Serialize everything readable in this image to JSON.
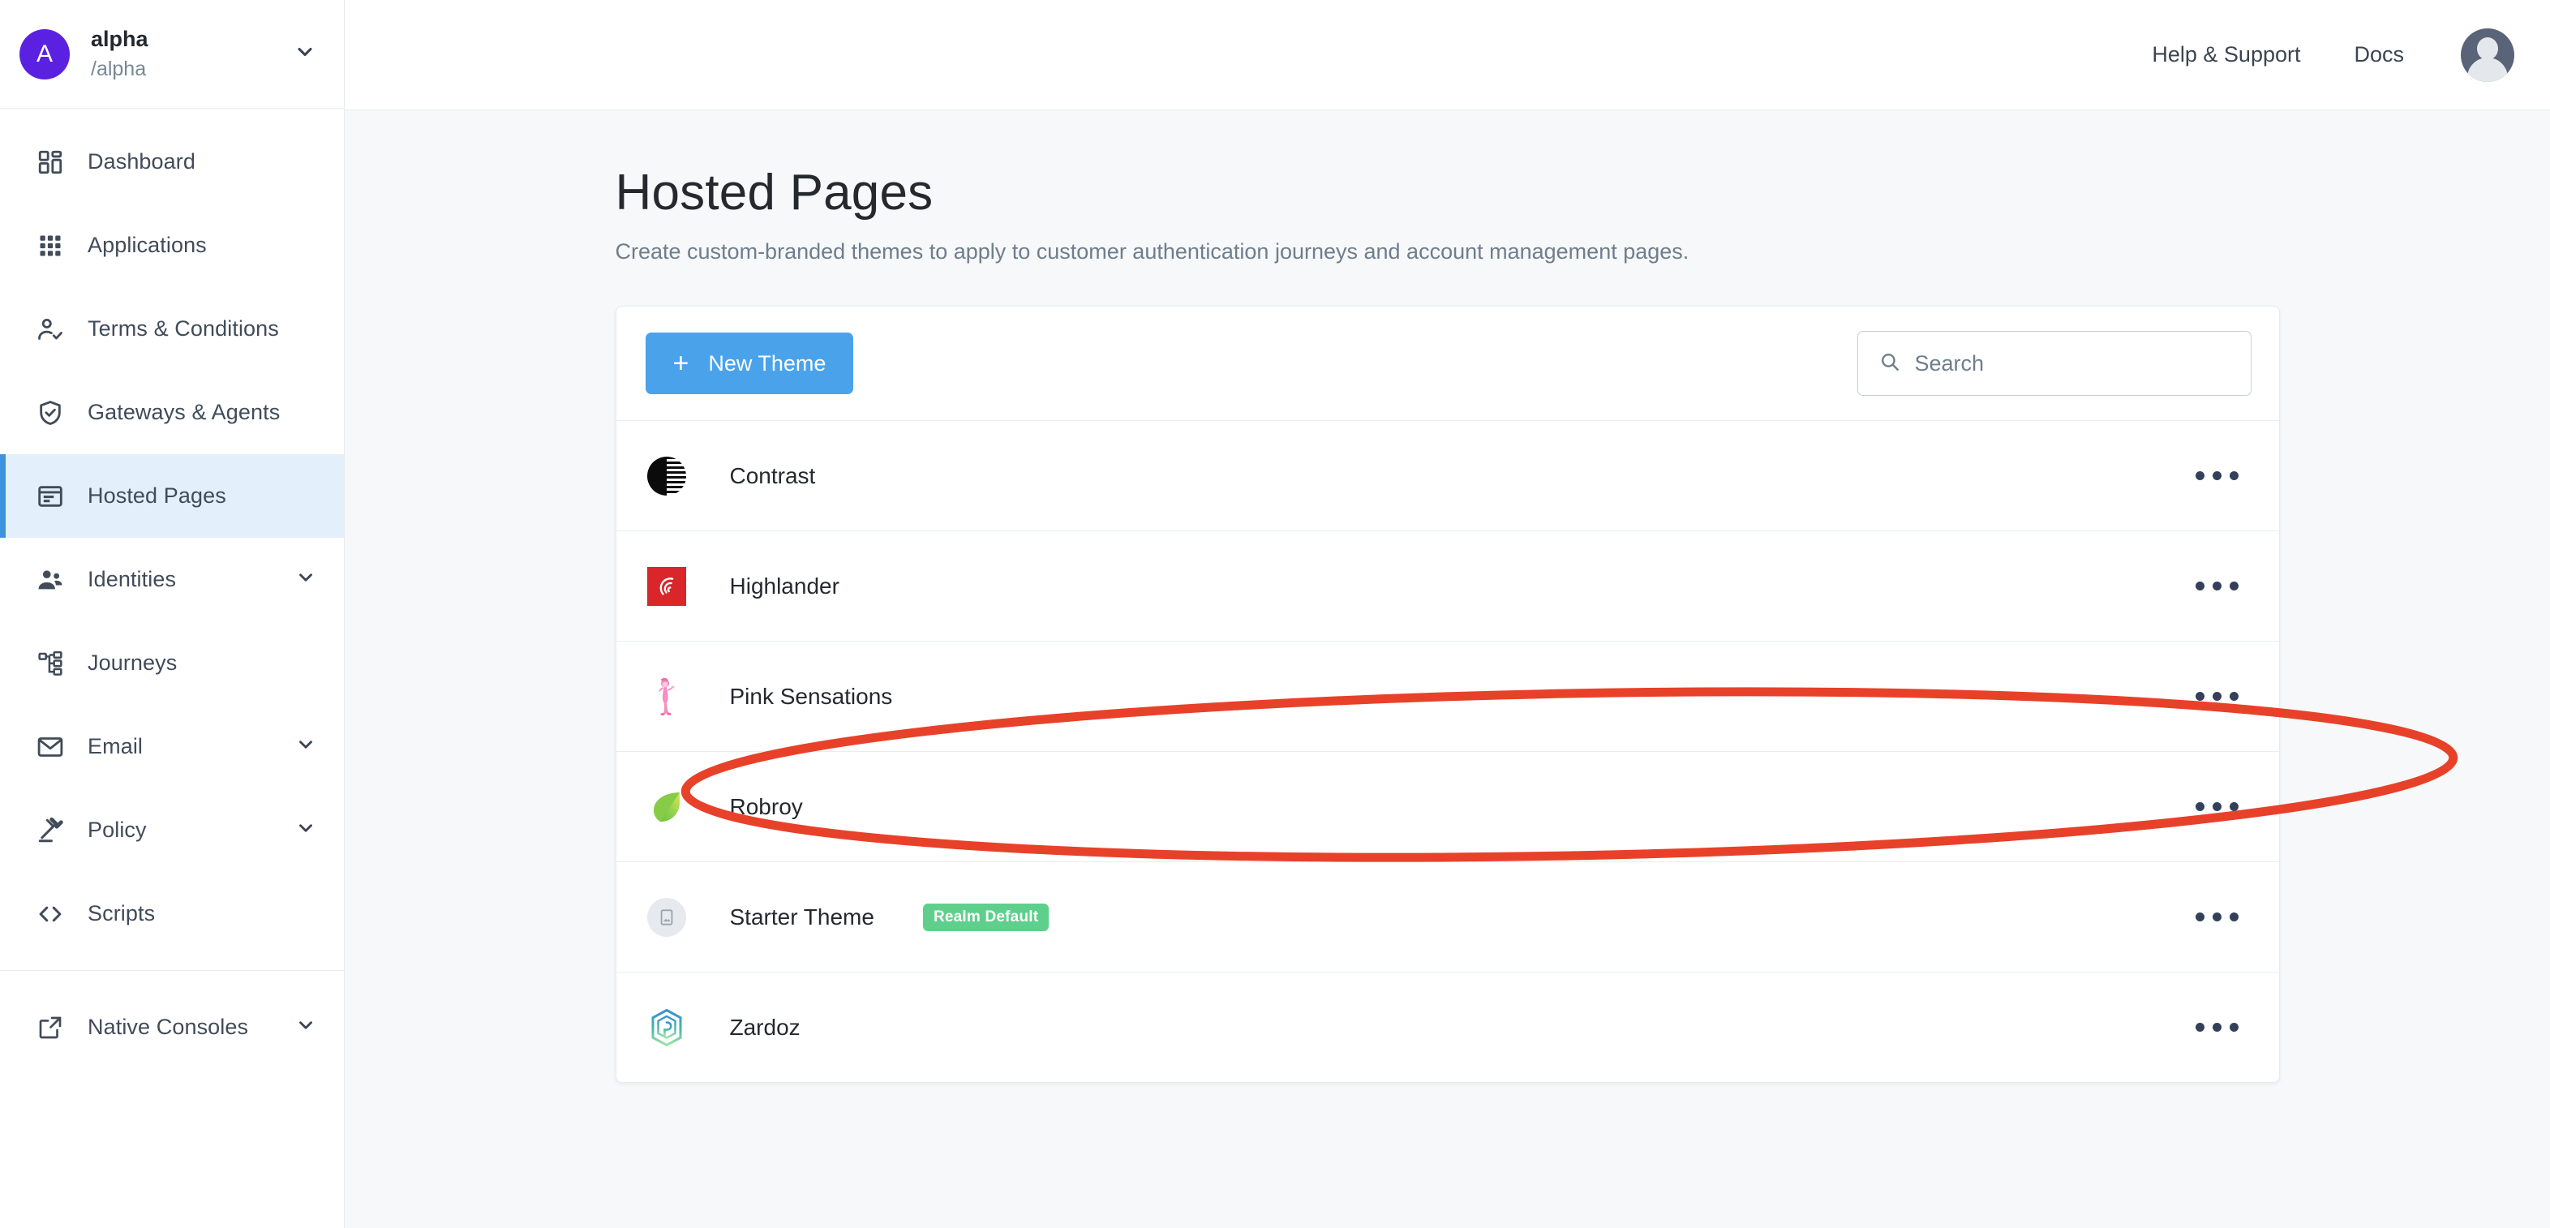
{
  "sidebar": {
    "realm": {
      "avatar_initial": "A",
      "name": "alpha",
      "path": "/alpha",
      "chevron_icon": "chevron-down-icon"
    },
    "items": [
      {
        "label": "Dashboard",
        "icon": "dashboard-icon",
        "active": false,
        "chevron": false
      },
      {
        "label": "Applications",
        "icon": "apps-grid-icon",
        "active": false,
        "chevron": false
      },
      {
        "label": "Terms & Conditions",
        "icon": "user-check-icon",
        "active": false,
        "chevron": false
      },
      {
        "label": "Gateways & Agents",
        "icon": "shield-check-icon",
        "active": false,
        "chevron": false
      },
      {
        "label": "Hosted Pages",
        "icon": "hosted-pages-icon",
        "active": true,
        "chevron": false
      },
      {
        "label": "Identities",
        "icon": "users-icon",
        "active": false,
        "chevron": true
      },
      {
        "label": "Journeys",
        "icon": "journeys-tree-icon",
        "active": false,
        "chevron": false
      },
      {
        "label": "Email",
        "icon": "envelope-icon",
        "active": false,
        "chevron": true
      },
      {
        "label": "Policy",
        "icon": "gavel-icon",
        "active": false,
        "chevron": true
      },
      {
        "label": "Scripts",
        "icon": "code-brackets-icon",
        "active": false,
        "chevron": false
      }
    ],
    "footer_items": [
      {
        "label": "Native Consoles",
        "icon": "external-link-icon",
        "active": false,
        "chevron": true
      }
    ]
  },
  "topbar": {
    "help_label": "Help & Support",
    "docs_label": "Docs",
    "avatar_icon": "user-avatar-icon"
  },
  "page": {
    "title": "Hosted Pages",
    "subtitle": "Create custom-branded themes to apply to customer authentication journeys and account management pages."
  },
  "toolbar": {
    "new_theme_label": "New Theme",
    "new_theme_plus": "+",
    "search_placeholder": "Search",
    "search_value": "",
    "search_icon": "search-icon"
  },
  "themes": [
    {
      "name": "Contrast",
      "icon": "contrast-theme-icon",
      "badge": ""
    },
    {
      "name": "Highlander",
      "icon": "highlander-theme-icon",
      "badge": ""
    },
    {
      "name": "Pink Sensations",
      "icon": "pink-panther-icon",
      "badge": ""
    },
    {
      "name": "Robroy",
      "icon": "green-leaf-icon",
      "badge": ""
    },
    {
      "name": "Starter Theme",
      "icon": "image-placeholder-icon",
      "badge": "Realm Default"
    },
    {
      "name": "Zardoz",
      "icon": "zardoz-hex-icon",
      "badge": ""
    }
  ],
  "row_menu_icon": "kebab-menu-icon",
  "annotation": {
    "shape": "ellipse-highlight",
    "color": "#E8412A",
    "target": "Pink Sensations"
  },
  "colors": {
    "accent_blue": "#4aa3ea",
    "active_nav_bg": "#e3f0fb",
    "active_nav_bar": "#3f93de",
    "badge_green": "#5ed08c",
    "realm_avatar": "#5B21E0",
    "page_bg": "#f6f8fa"
  }
}
